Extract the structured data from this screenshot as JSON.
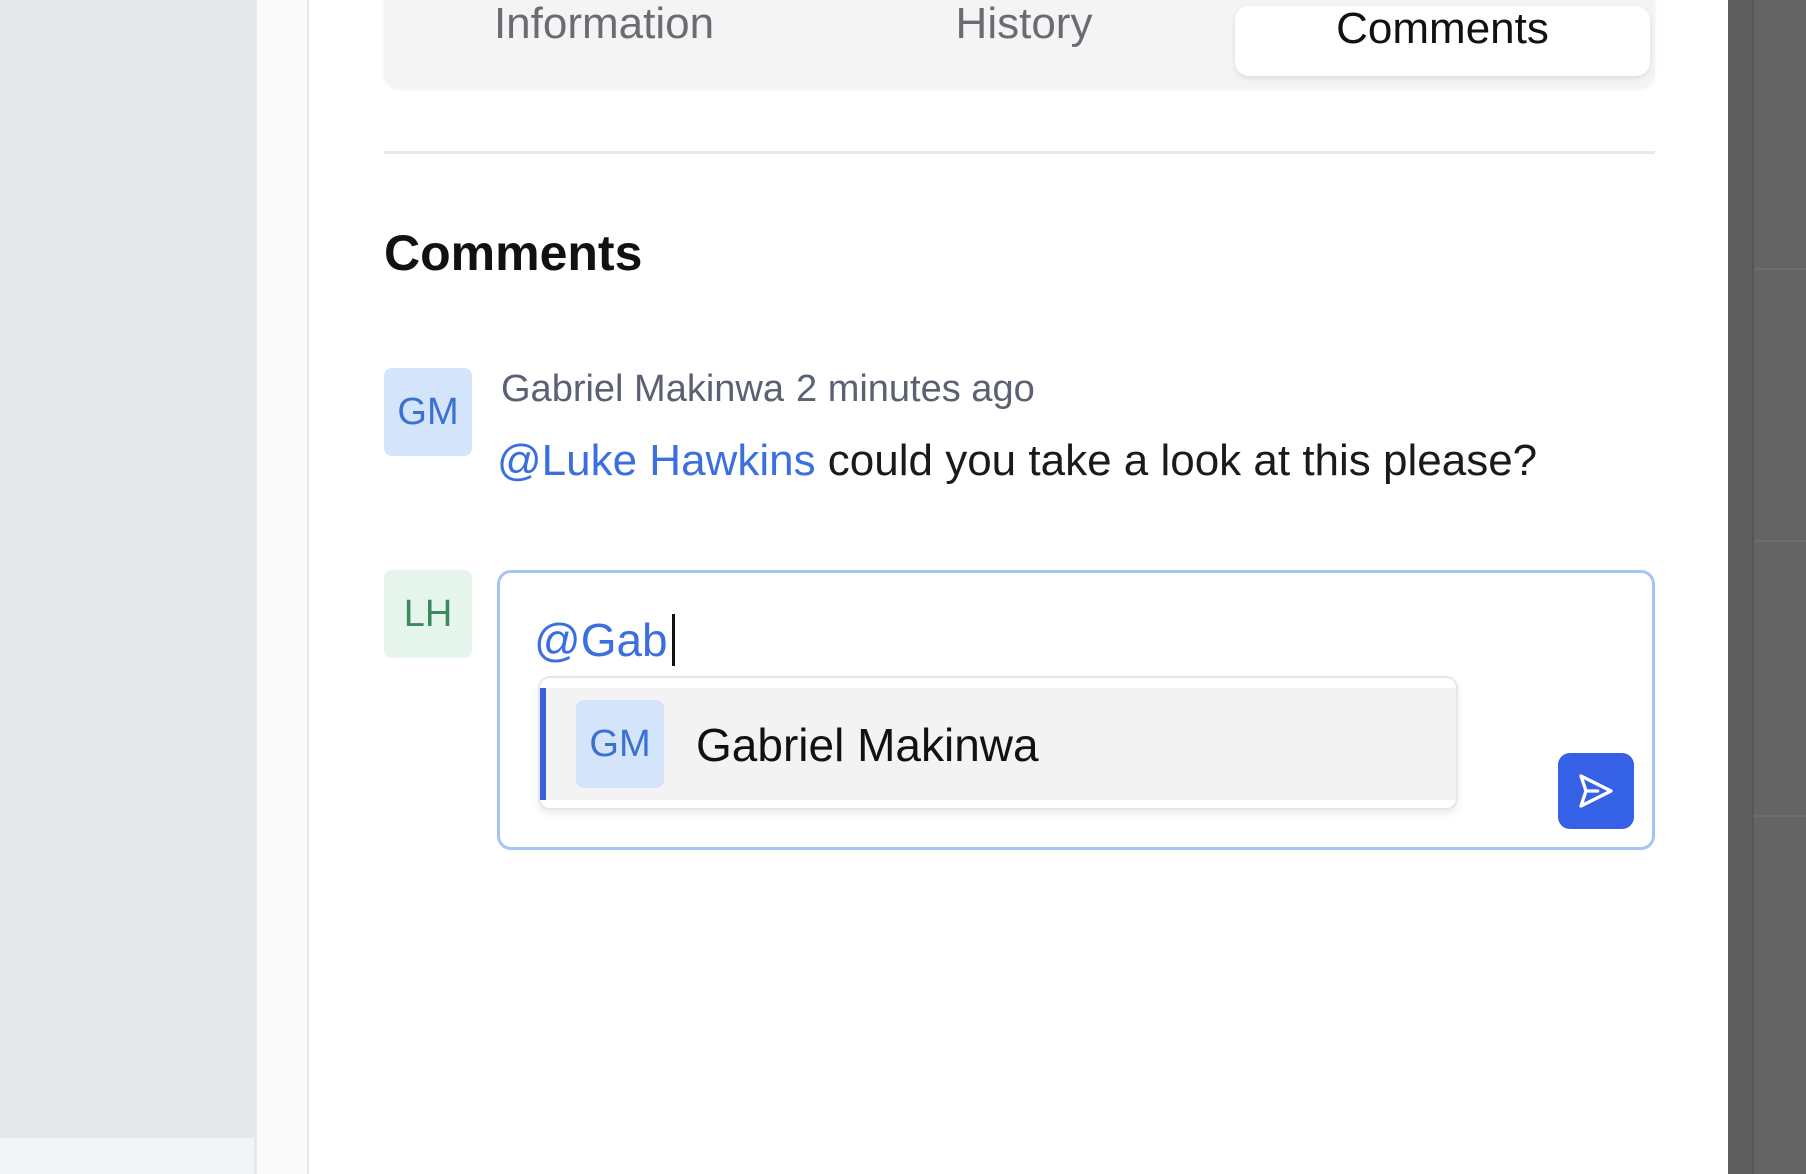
{
  "tabs": {
    "information": "Information",
    "history": "History",
    "comments": "Comments"
  },
  "section_title": "Comments",
  "comment": {
    "avatar_initials": "GM",
    "author": "Gabriel Makinwa",
    "time": "2 minutes ago",
    "mention": "@Luke Hawkins",
    "text": " could you take a look at this please?"
  },
  "composer": {
    "avatar_initials": "LH",
    "value": "@Gab",
    "suggestion": {
      "avatar_initials": "GM",
      "name": "Gabriel Makinwa"
    },
    "send_icon": "send-icon"
  },
  "colors": {
    "accent": "#3561e6",
    "mention": "#3b6fe0",
    "gm_avatar_bg": "#d4e4fb",
    "lh_avatar_bg": "#e6f5ec"
  }
}
